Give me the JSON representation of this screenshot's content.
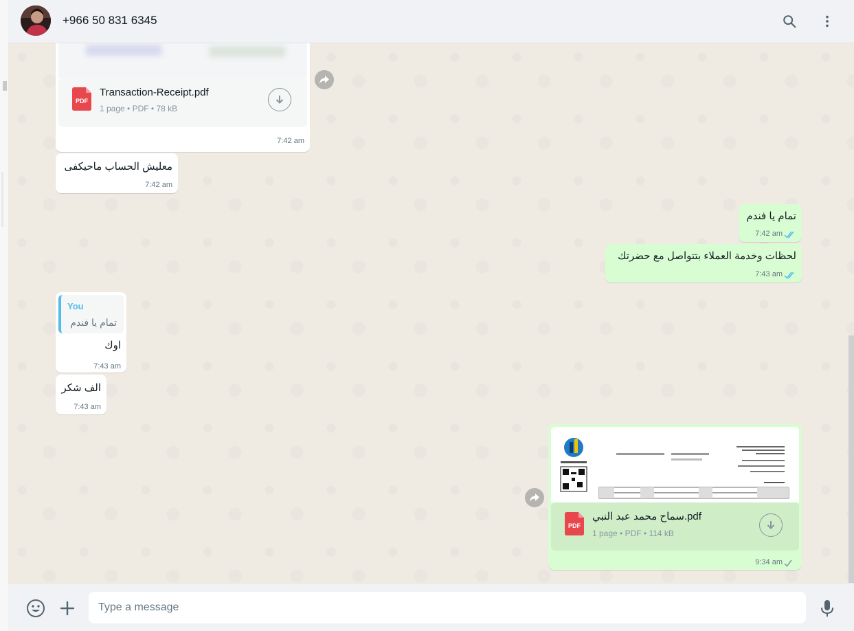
{
  "header": {
    "contact": "+966 50 831 6345",
    "search_icon": "search-icon",
    "menu_icon": "more-vertical-icon"
  },
  "messages": {
    "m1": {
      "file_name": "Transaction-Receipt.pdf",
      "file_meta": "1 page • PDF • 78 kB",
      "file_type": "PDF",
      "time": "7:42 am"
    },
    "m2": {
      "text": "معليش الحساب ماحيكفى",
      "time": "7:42 am"
    },
    "m3": {
      "text": "تمام يا فندم",
      "time": "7:42 am"
    },
    "m4": {
      "text": "لحظات وخدمة العملاء بتتواصل مع حضرتك",
      "time": "7:43 am"
    },
    "m5": {
      "quote_author": "You",
      "quote_text": "تمام يا فندم",
      "text": "اوك",
      "time": "7:43 am"
    },
    "m6": {
      "text": "الف شكر",
      "time": "7:43 am"
    },
    "m7": {
      "file_name": "سماح محمد عبد النبي.pdf",
      "file_meta": "1 page • PDF • 114 kB",
      "file_type": "PDF",
      "time": "9:34 am"
    }
  },
  "composer": {
    "placeholder": "Type a message",
    "emoji_icon": "emoji-icon",
    "attach_icon": "plus-icon",
    "mic_icon": "microphone-icon"
  },
  "colors": {
    "incoming": "#ffffff",
    "outgoing": "#d9fdd3",
    "read_ticks": "#53bdeb",
    "background": "#efeae2"
  }
}
